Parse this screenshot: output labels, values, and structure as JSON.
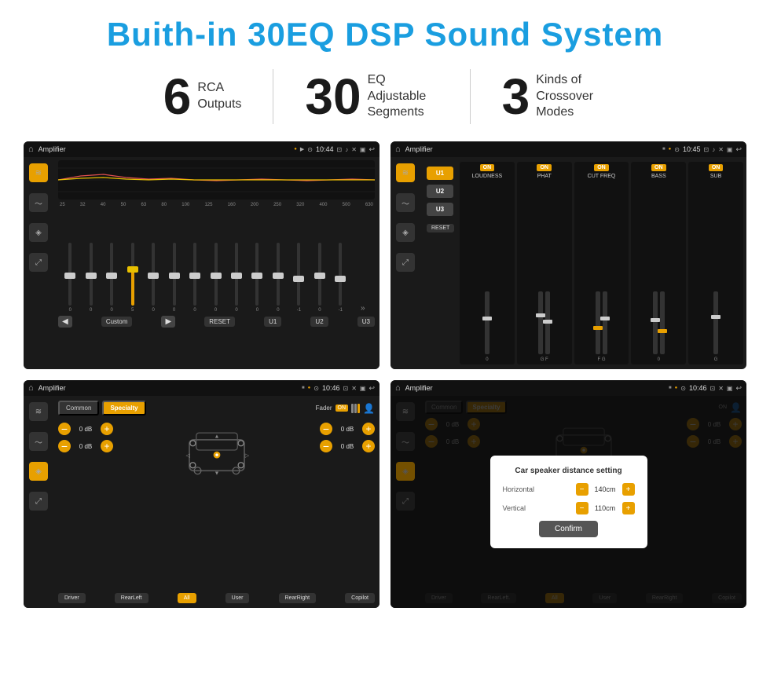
{
  "title": "Buith-in 30EQ DSP Sound System",
  "stats": [
    {
      "number": "6",
      "text": "RCA\nOutputs"
    },
    {
      "number": "30",
      "text": "EQ Adjustable\nSegments"
    },
    {
      "number": "3",
      "text": "Kinds of\nCrossover Modes"
    }
  ],
  "screen1": {
    "status_app": "Amplifier",
    "status_time": "10:44",
    "eq_freqs": [
      "25",
      "32",
      "40",
      "50",
      "63",
      "80",
      "100",
      "125",
      "160",
      "200",
      "250",
      "320",
      "400",
      "500",
      "630"
    ],
    "eq_values": [
      "0",
      "0",
      "0",
      "5",
      "0",
      "0",
      "0",
      "0",
      "0",
      "0",
      "0",
      "-1",
      "0",
      "-1"
    ],
    "buttons": [
      "Custom",
      "RESET",
      "U1",
      "U2",
      "U3"
    ]
  },
  "screen2": {
    "status_app": "Amplifier",
    "status_time": "10:45",
    "u_buttons": [
      "U1",
      "U2",
      "U3"
    ],
    "col_labels": [
      "LOUDNESS",
      "PHAT",
      "CUT FREQ",
      "BASS",
      "SUB"
    ],
    "reset_label": "RESET"
  },
  "screen3": {
    "status_app": "Amplifier",
    "status_time": "10:46",
    "tabs": [
      "Common",
      "Specialty"
    ],
    "fader_label": "Fader",
    "on_label": "ON",
    "db_values": [
      "0 dB",
      "0 dB",
      "0 dB",
      "0 dB"
    ],
    "bottom_btns": [
      "Driver",
      "RearLeft",
      "All",
      "User",
      "RearRight",
      "Copilot"
    ]
  },
  "screen4": {
    "status_app": "Amplifier",
    "status_time": "10:46",
    "tabs": [
      "Common",
      "Specialty"
    ],
    "dialog_title": "Car speaker distance setting",
    "horizontal_label": "Horizontal",
    "horizontal_value": "140cm",
    "vertical_label": "Vertical",
    "vertical_value": "110cm",
    "confirm_label": "Confirm",
    "db_values": [
      "0 dB",
      "0 dB"
    ],
    "bottom_btns": [
      "Driver",
      "RearLeft.",
      "All",
      "User",
      "RearRight",
      "Copilot"
    ]
  },
  "icons": {
    "home": "⌂",
    "back": "↩",
    "menu": "≡",
    "location": "📍",
    "camera": "📷",
    "volume": "🔊",
    "close": "✕",
    "window": "▣",
    "eq": "≋",
    "wave": "〜",
    "speaker": "◈",
    "expand": "⤢",
    "arrow_left": "◀",
    "arrow_right": "▶",
    "arrow_more": "»",
    "chevron_up": "▲",
    "chevron_down": "▼",
    "chevron_left": "◁",
    "chevron_right": "▷",
    "user": "👤"
  }
}
